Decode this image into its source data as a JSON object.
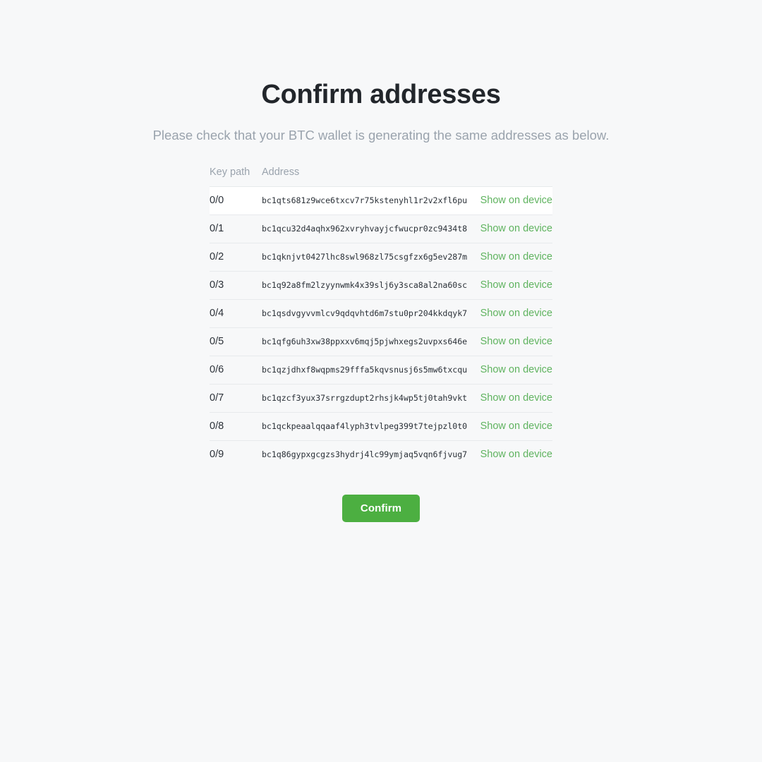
{
  "page": {
    "title": "Confirm addresses",
    "subtitle": "Please check that your BTC wallet is generating the same addresses as below.",
    "background_color": "#f7f8f9",
    "accent_color": "#4caf41",
    "link_color": "#5fb35f"
  },
  "table": {
    "headers": {
      "key_path": "Key path",
      "address": "Address",
      "action": ""
    },
    "rows": [
      {
        "key_path": "0/0",
        "address": "bc1qts681z9wce6txcv7r75kstenyhl1r2v2xfl6pu",
        "action_label": "Show on device",
        "highlighted": true
      },
      {
        "key_path": "0/1",
        "address": "bc1qcu32d4aqhx962xvryhvayjcfwucpr0zc9434t8",
        "action_label": "Show on device",
        "highlighted": false
      },
      {
        "key_path": "0/2",
        "address": "bc1qknjvt0427lhc8swl968zl75csgfzx6g5ev287m",
        "action_label": "Show on device",
        "highlighted": false
      },
      {
        "key_path": "0/3",
        "address": "bc1q92a8fm2lzyynwmk4x39slj6y3sca8al2na60sc",
        "action_label": "Show on device",
        "highlighted": false
      },
      {
        "key_path": "0/4",
        "address": "bc1qsdvgyvvmlcv9qdqvhtd6m7stu0pr204kkdqyk7",
        "action_label": "Show on device",
        "highlighted": false
      },
      {
        "key_path": "0/5",
        "address": "bc1qfg6uh3xw38ppxxv6mqj5pjwhxegs2uvpxs646e",
        "action_label": "Show on device",
        "highlighted": false
      },
      {
        "key_path": "0/6",
        "address": "bc1qzjdhxf8wqpms29fffa5kqvsnusj6s5mw6txcqu",
        "action_label": "Show on device",
        "highlighted": false
      },
      {
        "key_path": "0/7",
        "address": "bc1qzcf3yux37srrgzdupt2rhsjk4wp5tj0tah9vkt",
        "action_label": "Show on device",
        "highlighted": false
      },
      {
        "key_path": "0/8",
        "address": "bc1qckpeaalqqaaf4lyph3tvlpeg399t7tejpzl0t0",
        "action_label": "Show on device",
        "highlighted": false
      },
      {
        "key_path": "0/9",
        "address": "bc1q86gypxgcgzs3hydrj4lc99ymjaq5vqn6fjvug7",
        "action_label": "Show on device",
        "highlighted": false
      }
    ]
  },
  "footer": {
    "confirm_label": "Confirm"
  }
}
